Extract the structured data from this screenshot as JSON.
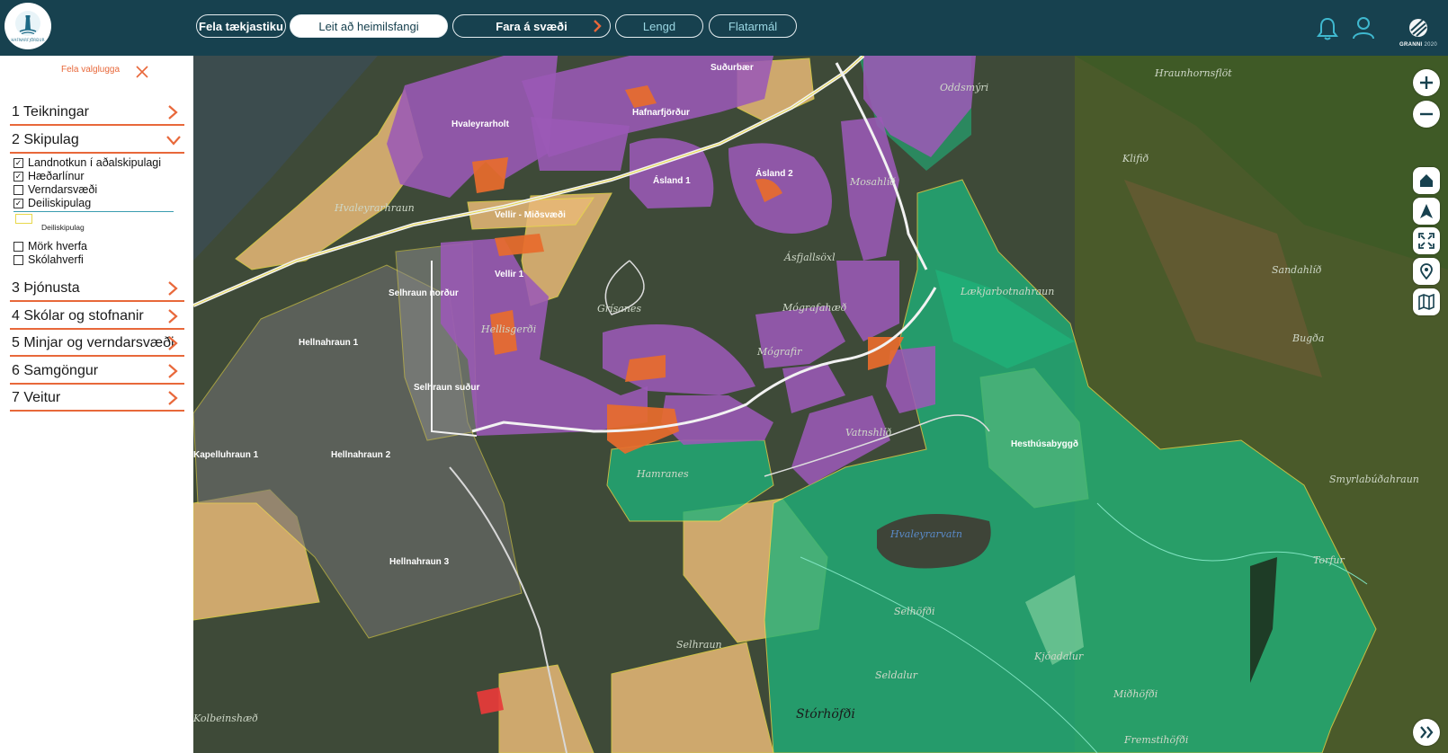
{
  "app": {
    "logo_text": "HAFNARFJÖRÐUR",
    "brand_name": "GRANNI",
    "brand_year": "2020"
  },
  "toolbar": {
    "hide_toolbar": "Fela tækjastiku",
    "address_search_placeholder": "Leit að heimilsfangi",
    "go_to_area": "Fara á svæði",
    "length": "Lengd",
    "area": "Flatarmál"
  },
  "sidebar": {
    "hide_panel": "Fela valglugga",
    "items": [
      {
        "label": "1 Teikningar",
        "expanded": false
      },
      {
        "label": "2 Skipulag",
        "expanded": true
      },
      {
        "label": "3 Þjónusta",
        "expanded": false
      },
      {
        "label": "4 Skólar og stofnanir",
        "expanded": false
      },
      {
        "label": "5 Minjar og verndarsvæði",
        "expanded": false
      },
      {
        "label": "6 Samgöngur",
        "expanded": false
      },
      {
        "label": "7 Veitur",
        "expanded": false
      }
    ],
    "layers_group1": [
      {
        "label": "Landnotkun í aðalskipulagi",
        "checked": true
      },
      {
        "label": "Hæðarlínur",
        "checked": true
      },
      {
        "label": "Verndarsvæði",
        "checked": false
      },
      {
        "label": "Deiliskipulag",
        "checked": true
      }
    ],
    "legend_label": "Deiliskipulag",
    "layers_group2": [
      {
        "label": "Mörk hverfa",
        "checked": false
      },
      {
        "label": "Skólahverfi",
        "checked": false
      }
    ]
  },
  "map": {
    "labels": {
      "hvaleyrarholt": "Hvaleyrarholt",
      "sudurbaer": "Suðurbær",
      "hafnarfjordur": "Hafnarfjörður",
      "asland1": "Ásland 1",
      "asland2": "Ásland 2",
      "vellir_midsvaedi": "Vellir - Miðsvæði",
      "vellir1": "Vellir 1",
      "selhraun_nordur": "Selhraun norður",
      "selhraun_sudur": "Selhraun suður",
      "hellnahraun1": "Hellnahraun 1",
      "hellnahraun2": "Hellnahraun 2",
      "hellnahraun3": "Hellnahraun 3",
      "kapelluhraun1": "Kapelluhraun 1",
      "hesthusabyggd": "Hesthúsabyggð",
      "hraunhornsflot": "Hraunhornsflöt",
      "oddsmyri": "Oddsmýri",
      "asfjallsoxl": "Ásfjallsöxl",
      "mosahlid": "Mosahlíð",
      "mografahaed": "Mógrafahæð",
      "mografir": "Mógrafir",
      "vatnshlid": "Vatnshlíð",
      "hamranes": "Hamranes",
      "laekjarbotnahraun": "Lækjarbotnahraun",
      "selhofdi": "Selhöfði",
      "seldalur": "Seldalur",
      "storhofdi": "Stórhöfði",
      "midhofdi": "Miðhöfði",
      "fremstihofdi": "Fremstihöfði",
      "kjoadalur": "Kjóadalur",
      "torfur": "Torfur",
      "hvaleyrarhraun": "Hvaleyrarhraun",
      "grisanes": "Grísanes",
      "hellisgerdi": "Hellisgerði",
      "selhraun": "Selhraun",
      "kolbeinshaed": "Kolbeinshæð",
      "sandahlid": "Sandahlíð",
      "styrilaboduhraun": "Smyrlabúðahraun",
      "klifsholt": "Klifið",
      "bugdulaekur": "Bugða",
      "hvaleyrarvatn": "Hvaleyrarvatn"
    }
  },
  "colors": {
    "topbar": "#17414f",
    "accent": "#e8683a",
    "residential": "#9b59b6",
    "industry": "#e86b2c",
    "recreation": "#1fb27a",
    "future": "#e8b977",
    "detail_plan_border": "#e8d84a"
  },
  "icons": {
    "bell": "bell-icon",
    "user": "user-icon",
    "zoom_in": "plus-icon",
    "zoom_out": "minus-icon",
    "home": "home-icon",
    "navigate": "navigation-arrow-icon",
    "fullscreen": "fullscreen-icon",
    "location": "location-pin-icon",
    "basemap": "map-icon",
    "expand": "double-chevron-right-icon"
  }
}
